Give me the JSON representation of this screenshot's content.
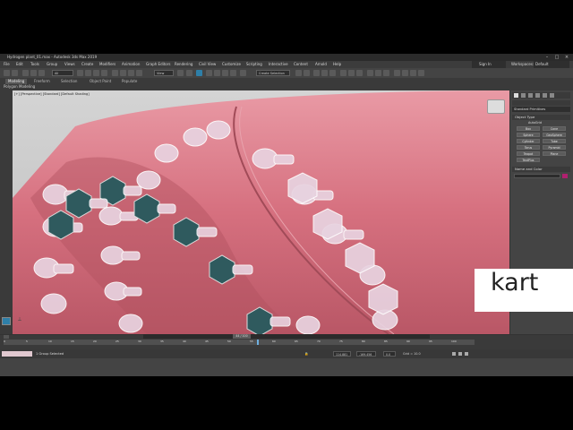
{
  "window": {
    "title": "Hydrogen plant_01.max - Autodesk 3ds Max 2019",
    "controls": [
      "–",
      "□",
      "×"
    ]
  },
  "menubar": {
    "items": [
      "File",
      "Edit",
      "Tools",
      "Group",
      "Views",
      "Create",
      "Modifiers",
      "Animation",
      "Graph Editors",
      "Rendering",
      "Civil View",
      "Customize",
      "Scripting",
      "Interactive",
      "Content",
      "Arnold",
      "Help"
    ],
    "sign_in": "Sign In",
    "workspaces_label": "Workspaces:",
    "workspaces_value": "Default"
  },
  "toolbar": {
    "filter_value": "All",
    "view_value": "View",
    "selection_set_placeholder": "Create Selection Se"
  },
  "ribbon": {
    "tabs": [
      "Modeling",
      "Freeform",
      "Selection",
      "Object Paint",
      "Populate"
    ],
    "active_tab": "Modeling",
    "sub_label": "Polygon Modeling"
  },
  "viewport": {
    "label": "[+] [Perspective] [Standard] [Default Shading]",
    "bolt_color": "#e8d3e0",
    "selected_bolt_color": "#2f5a5e",
    "pipe_color": "#d4707f"
  },
  "command_panel": {
    "category_label": "Standard Primitives",
    "rollout_object_type": "Object Type",
    "autogrid_label": "AutoGrid",
    "buttons": [
      "Box",
      "Cone",
      "Sphere",
      "GeoSphere",
      "Cylinder",
      "Tube",
      "Torus",
      "Pyramid",
      "Teapot",
      "Plane",
      "TextPlus"
    ],
    "rollout_name_color": "Name and Color",
    "color_swatch": "#b0206f"
  },
  "timeline": {
    "frame_display": "44 / 100",
    "ticks": [
      "0",
      "5",
      "10",
      "15",
      "20",
      "25",
      "30",
      "35",
      "40",
      "45",
      "50",
      "55",
      "60",
      "65",
      "70",
      "75",
      "80",
      "85",
      "90",
      "95",
      "100"
    ]
  },
  "statusbar": {
    "status_text": "1 Group Selected",
    "x_value": "114.881",
    "y_value": "-169.456",
    "z_value": "0.0",
    "grid_label": "Grid = 10.0"
  },
  "watermark": {
    "text": "kart"
  }
}
